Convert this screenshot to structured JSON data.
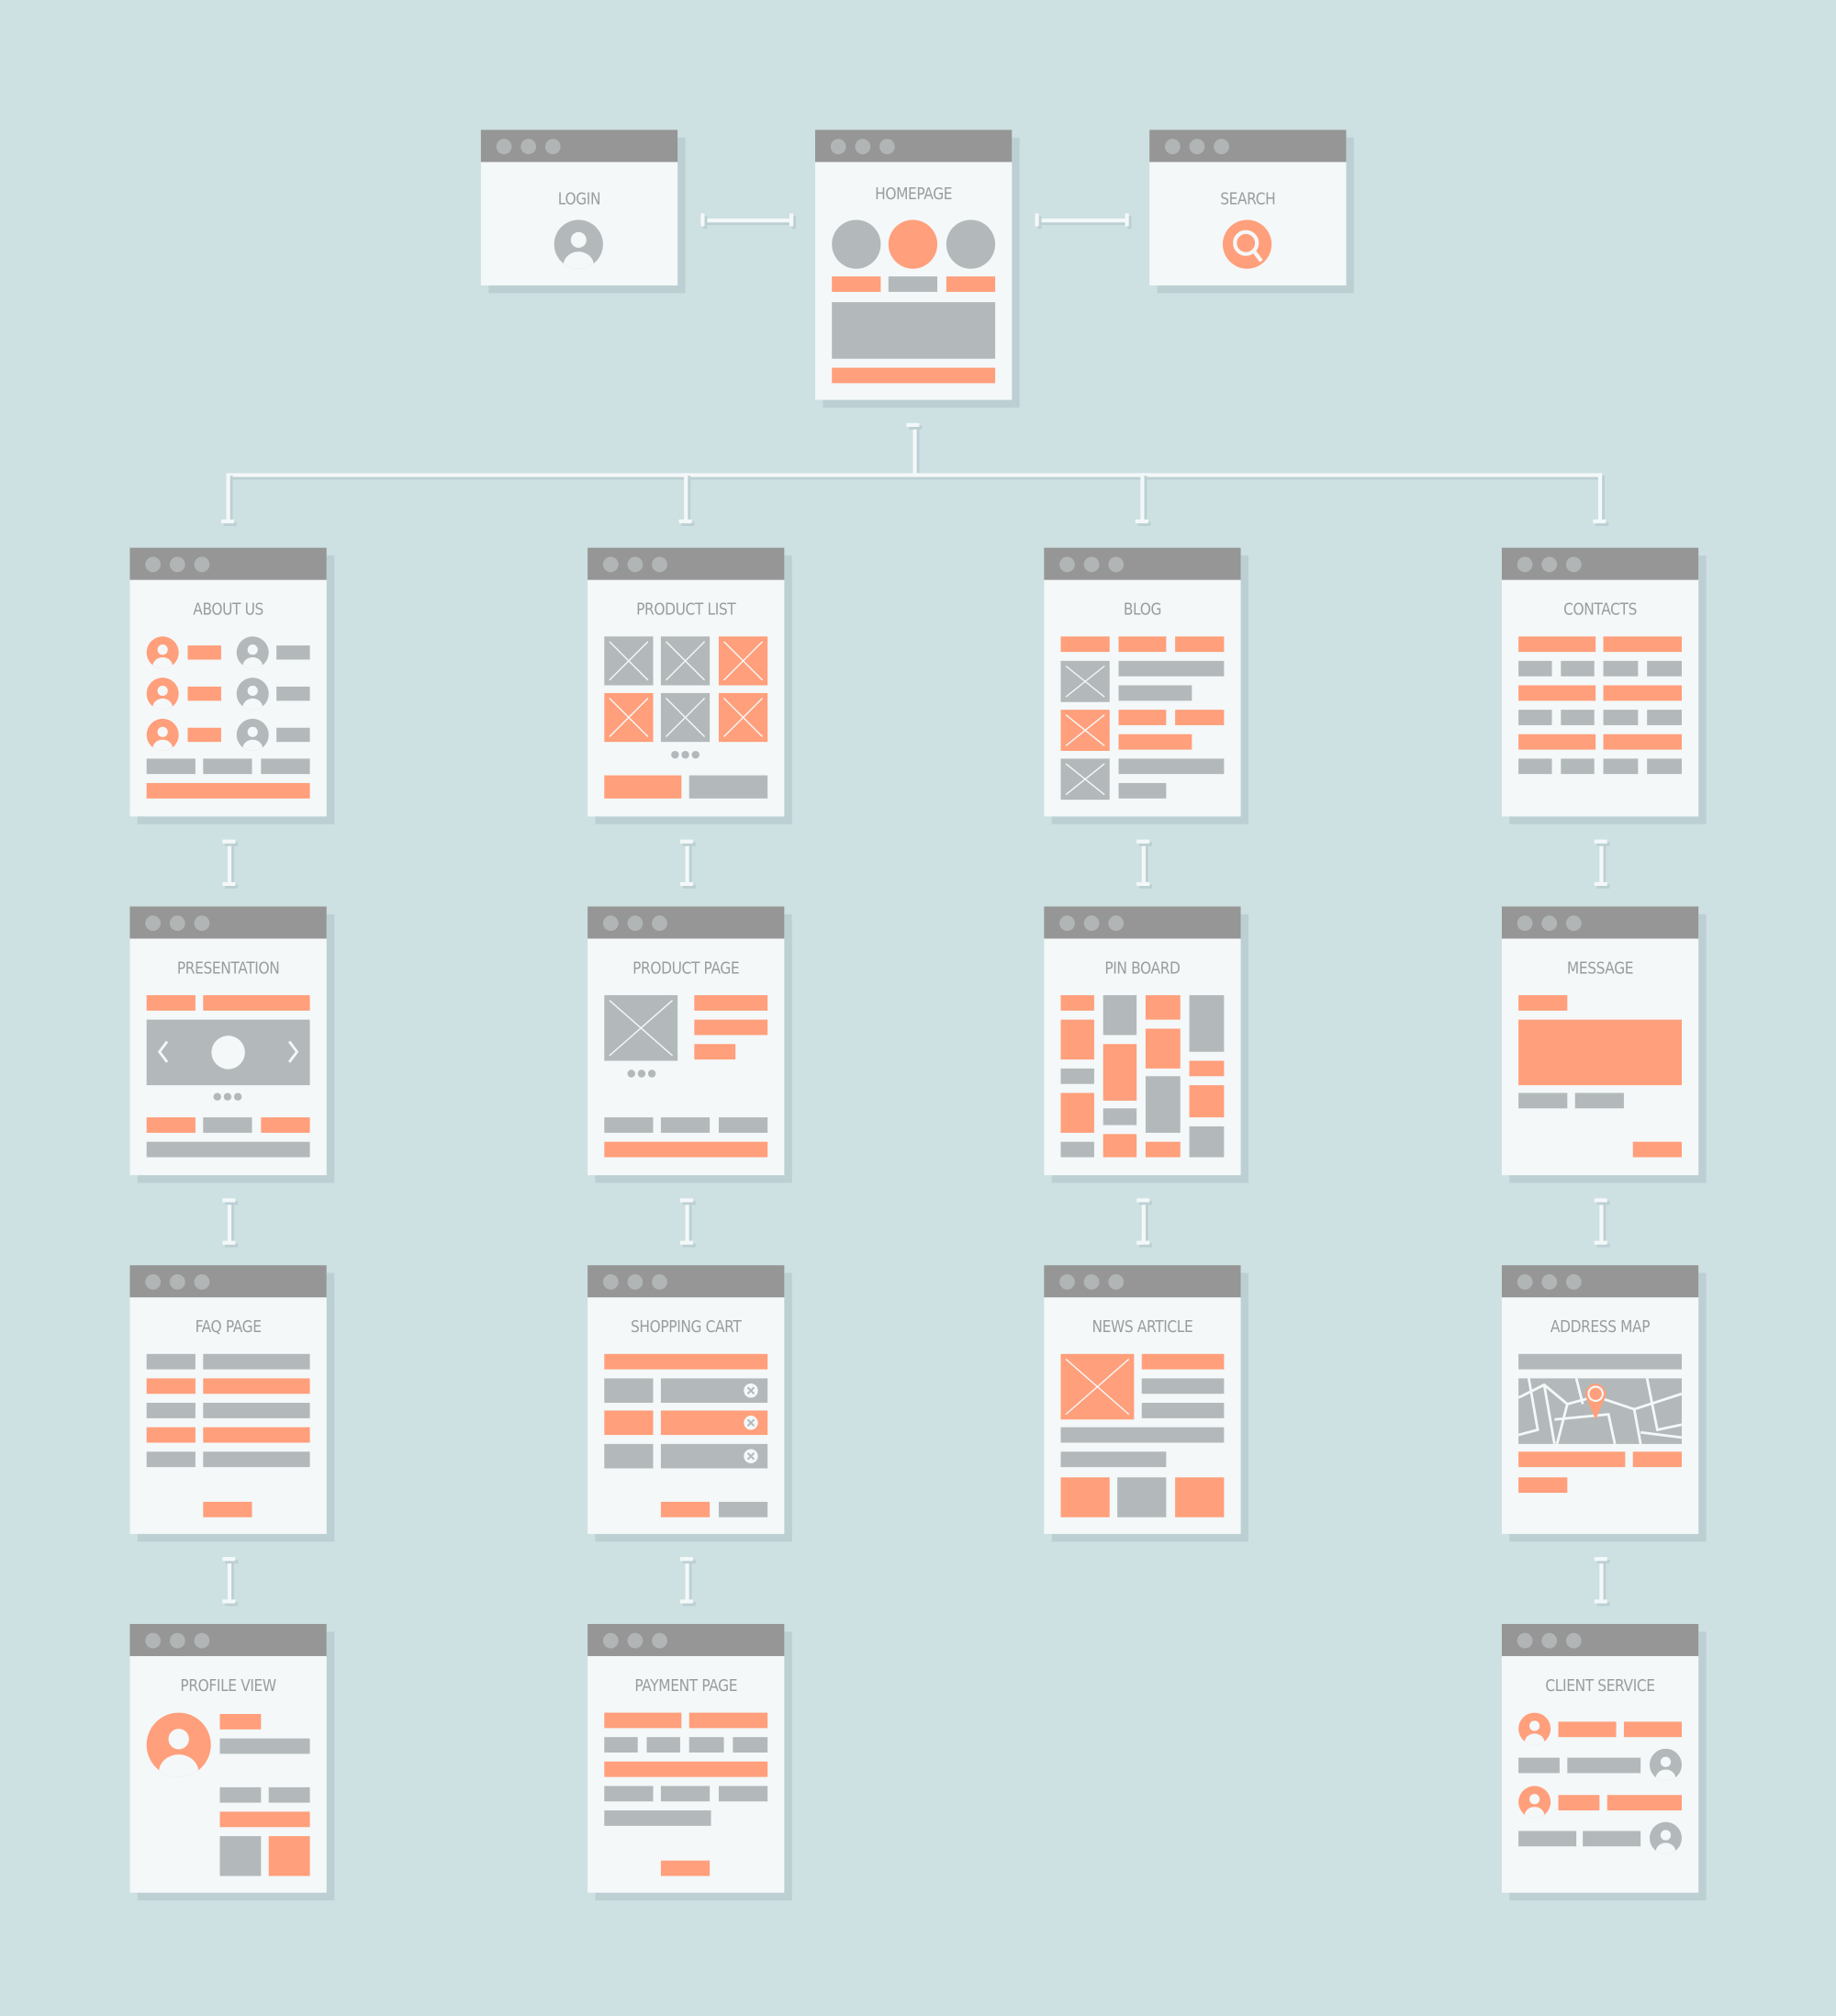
{
  "colors": {
    "background": "#cde0e2",
    "card": "#f4f8f9",
    "header": "#959695",
    "accent": "#ff9f7b",
    "block": "#b3b9ba",
    "title": "#9a9d9e"
  },
  "top_pages": [
    {
      "id": "login",
      "title": "LOGIN"
    },
    {
      "id": "homepage",
      "title": "HOMEPAGE"
    },
    {
      "id": "search",
      "title": "SEARCH"
    }
  ],
  "columns": [
    {
      "pages": [
        {
          "id": "about-us",
          "title": "ABOUT US"
        },
        {
          "id": "presentation",
          "title": "PRESENTATION"
        },
        {
          "id": "faq-page",
          "title": "FAQ PAGE"
        },
        {
          "id": "profile-view",
          "title": "PROFILE VIEW"
        }
      ]
    },
    {
      "pages": [
        {
          "id": "product-list",
          "title": "PRODUCT LIST"
        },
        {
          "id": "product-page",
          "title": "PRODUCT PAGE"
        },
        {
          "id": "shopping-cart",
          "title": "SHOPPING CART"
        },
        {
          "id": "payment-page",
          "title": "PAYMENT PAGE"
        }
      ]
    },
    {
      "pages": [
        {
          "id": "blog",
          "title": "BLOG"
        },
        {
          "id": "pin-board",
          "title": "PIN BOARD"
        },
        {
          "id": "news-article",
          "title": "NEWS ARTICLE"
        }
      ]
    },
    {
      "pages": [
        {
          "id": "contacts",
          "title": "CONTACTS"
        },
        {
          "id": "message",
          "title": "MESSAGE"
        },
        {
          "id": "address-map",
          "title": "ADDRESS MAP"
        },
        {
          "id": "client-service",
          "title": "CLIENT SERVICE"
        }
      ]
    }
  ],
  "icons": {
    "login": "user-icon",
    "search": "search-icon",
    "placeholder": "image-placeholder-icon",
    "remove": "remove-icon",
    "map_pin": "map-pin-icon"
  }
}
